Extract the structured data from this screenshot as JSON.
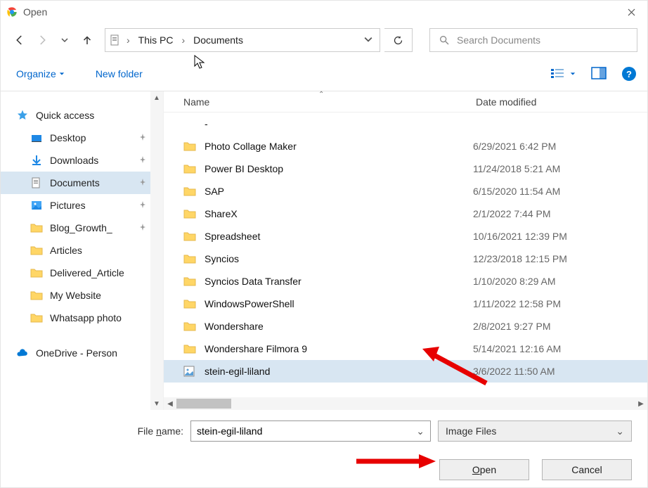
{
  "title": "Open",
  "breadcrumb": {
    "pc": "This PC",
    "folder": "Documents"
  },
  "search_placeholder": "Search Documents",
  "toolbar": {
    "organize": "Organize",
    "new_folder": "New folder"
  },
  "sidebar": {
    "quick_access": "Quick access",
    "items": [
      {
        "label": "Desktop",
        "pinned": true
      },
      {
        "label": "Downloads",
        "pinned": true
      },
      {
        "label": "Documents",
        "pinned": true,
        "selected": true
      },
      {
        "label": "Pictures",
        "pinned": true
      },
      {
        "label": "Blog_Growth_",
        "pinned": true
      },
      {
        "label": "Articles"
      },
      {
        "label": "Delivered_Article"
      },
      {
        "label": "My Website"
      },
      {
        "label": "Whatsapp photo"
      }
    ],
    "onedrive": "OneDrive - Person"
  },
  "columns": {
    "name": "Name",
    "date": "Date modified"
  },
  "rows": [
    {
      "name": "-",
      "date": "",
      "type": "folder",
      "hidden_dash": true
    },
    {
      "name": "Photo Collage Maker",
      "date": "6/29/2021 6:42 PM",
      "type": "folder"
    },
    {
      "name": "Power BI Desktop",
      "date": "11/24/2018 5:21 AM",
      "type": "folder"
    },
    {
      "name": "SAP",
      "date": "6/15/2020 11:54 AM",
      "type": "folder"
    },
    {
      "name": "ShareX",
      "date": "2/1/2022 7:44 PM",
      "type": "folder"
    },
    {
      "name": "Spreadsheet",
      "date": "10/16/2021 12:39 PM",
      "type": "folder"
    },
    {
      "name": "Syncios",
      "date": "12/23/2018 12:15 PM",
      "type": "folder"
    },
    {
      "name": "Syncios Data Transfer",
      "date": "1/10/2020 8:29 AM",
      "type": "folder"
    },
    {
      "name": "WindowsPowerShell",
      "date": "1/11/2022 12:58 PM",
      "type": "folder"
    },
    {
      "name": "Wondershare",
      "date": "2/8/2021 9:27 PM",
      "type": "folder"
    },
    {
      "name": "Wondershare Filmora 9",
      "date": "5/14/2021 12:16 AM",
      "type": "folder"
    },
    {
      "name": "stein-egil-liland",
      "date": "3/6/2022 11:50 AM",
      "type": "file",
      "selected": true
    }
  ],
  "footer": {
    "filename_label_pre": "File ",
    "filename_label_u": "n",
    "filename_label_post": "ame:",
    "filename_value": "stein-egil-liland",
    "filter": "Image Files",
    "open_u": "O",
    "open_post": "pen",
    "cancel": "Cancel"
  }
}
